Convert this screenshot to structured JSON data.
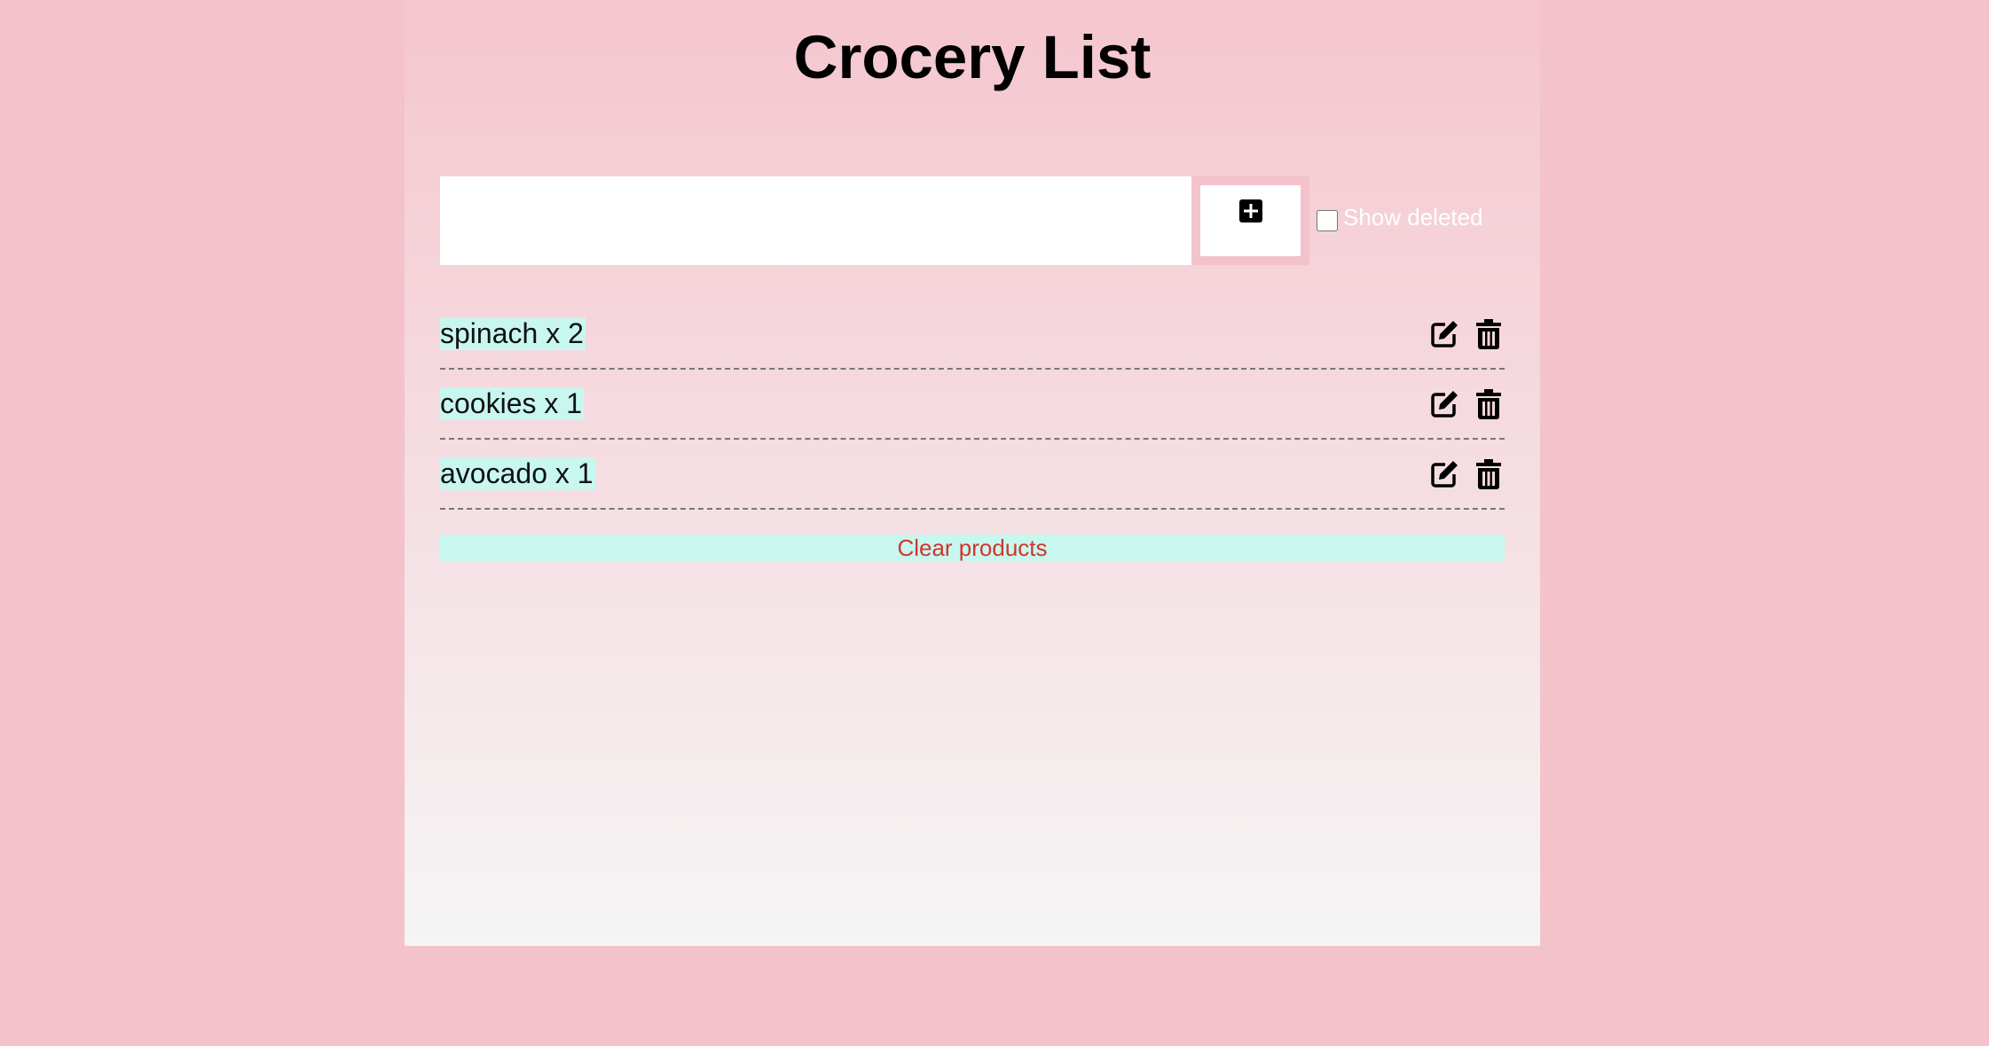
{
  "page": {
    "title": "Crocery List"
  },
  "input": {
    "value": "",
    "placeholder": ""
  },
  "add_button": {
    "icon": "plus-square-icon"
  },
  "show_deleted": {
    "label": "Show deleted",
    "checked": false
  },
  "items": [
    {
      "label": "spinach x 2",
      "edit_icon": "edit-icon",
      "delete_icon": "trash-icon"
    },
    {
      "label": "cookies x 1",
      "edit_icon": "edit-icon",
      "delete_icon": "trash-icon"
    },
    {
      "label": "avocado x 1",
      "edit_icon": "edit-icon",
      "delete_icon": "trash-icon"
    }
  ],
  "clear_button": {
    "label": "Clear products"
  },
  "colors": {
    "background": "#f4c2cb",
    "item_highlight": "#c8f7f0",
    "clear_text": "#d0362a"
  }
}
